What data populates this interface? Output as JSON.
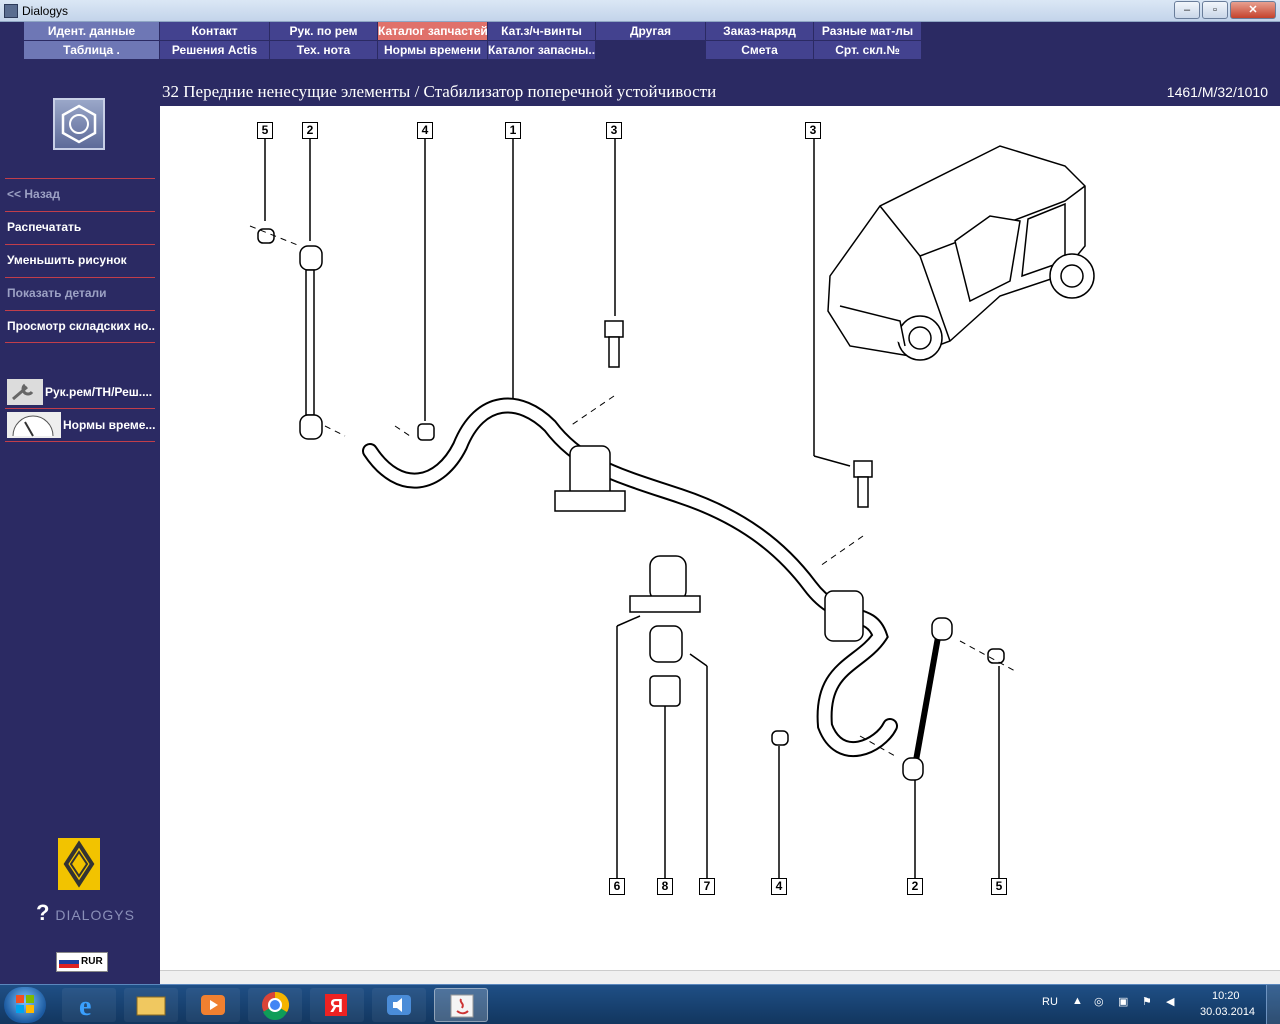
{
  "window": {
    "title": "Dialogys",
    "minimize": "–",
    "maximize": "▫",
    "close": "✕"
  },
  "menu": {
    "row1": [
      "Идент. данные",
      "Контакт",
      "Рук. по рем",
      "Каталог запчастей",
      "Кат.з/ч-винты",
      "Другая",
      "Заказ-наряд",
      "Разные мат-лы"
    ],
    "row2": [
      "Таблица .",
      "Решения Actis",
      "Тех. нота",
      "Нормы времени",
      "Каталог запасны...",
      "Смета",
      "Срт. скл.№"
    ]
  },
  "header": {
    "heading": "32 Передние ненесущие элементы / Стабилизатор поперечной устойчивости",
    "code": "1461/M/32/1010"
  },
  "sidebar": {
    "back": "<< Назад",
    "print": "Распечатать",
    "shrink": "Уменьшить рисунок",
    "show_details": "Показать детали",
    "stock_view": "Просмотр складских но...",
    "tool1": "Рук.рем/ТН/Реш....",
    "tool2": "Нормы време...",
    "brand": "DIALOGYS",
    "currency": "RUR"
  },
  "callouts": {
    "top": [
      "5",
      "2",
      "4",
      "1",
      "3",
      "3"
    ],
    "bottom": [
      "6",
      "8",
      "7",
      "4",
      "2",
      "5"
    ]
  },
  "taskbar": {
    "lang": "RU",
    "time": "10:20",
    "date": "30.03.2014"
  },
  "colors": {
    "bg": "#2b2a63",
    "menu": "#43428f",
    "menu_light": "#6e77b5",
    "active": "#e0716a",
    "divider": "#c23e4a"
  }
}
